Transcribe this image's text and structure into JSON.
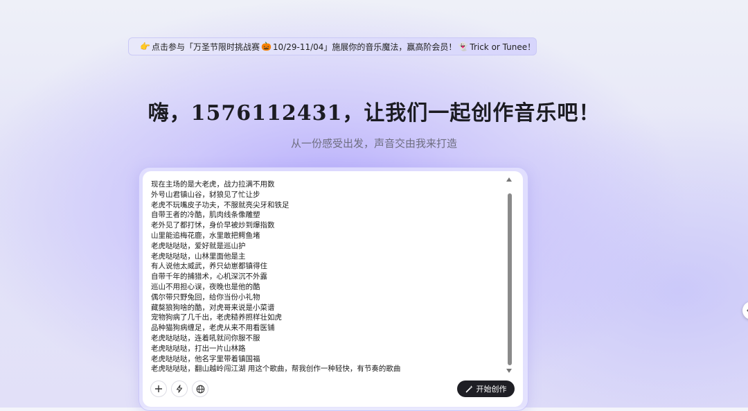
{
  "banner": {
    "icon_pointer": "👉",
    "text_part1": "点击参与「万圣节限时挑战赛",
    "icon_pumpkin": "🎃",
    "text_part2": "10/29-11/04」施展你的音乐魔法，赢高阶会员！",
    "icon_ghost": "👻",
    "text_part3": "Trick or Tunee！"
  },
  "greeting": {
    "title": "嗨，1576112431，让我们一起创作音乐吧！",
    "subtitle": "从一份感受出发，声音交由我来打造"
  },
  "prompt": {
    "lines": [
      "现在主场的是大老虎，战力拉满不用数",
      "外号山君镇山谷，豺狼见了忙让步",
      "老虎不玩嘴皮子功夫，不服就亮尖牙和铁足",
      "自带王者的冷酷，肌肉线条像雕塑",
      "老外见了都打怵，身价早被炒到爆指数",
      "山里能追梅花鹿，水里敢把鳄鱼堵",
      "老虎哒哒哒，爱好就是巡山护",
      "老虎哒哒哒，山林里面他是主",
      "有人说他太威武，养只幼崽都镇得住",
      "自带千年的捕猎术，心机深沉不外露",
      "巡山不用担心误，夜晚也是他的酷",
      "偶尔带只野兔回，给你当份小礼物",
      "藏獒狼狗啥的酷，对虎哥来说是小菜谱",
      "宠物狗病了几千出，老虎糙养照样壮如虎",
      "品种猫狗病缠足，老虎从来不用看医铺",
      "老虎哒哒哒，连着吼就问你服不服",
      "老虎哒哒哒，打出一片山林路",
      "老虎哒哒哒，他名字里带着镇国福",
      "老虎哒哒哒，翻山越岭闯江湖 用这个歌曲，帮我创作一种轻快，有节奏的歌曲"
    ]
  },
  "toolbar": {
    "add_icon": "plus-icon",
    "flash_icon": "lightning-icon",
    "globe_icon": "globe-icon",
    "start_label": "开始创作",
    "start_icon": "magic-wand-icon"
  },
  "colors": {
    "accent": "#b0a5fc",
    "button_dark": "#1f1f25"
  }
}
